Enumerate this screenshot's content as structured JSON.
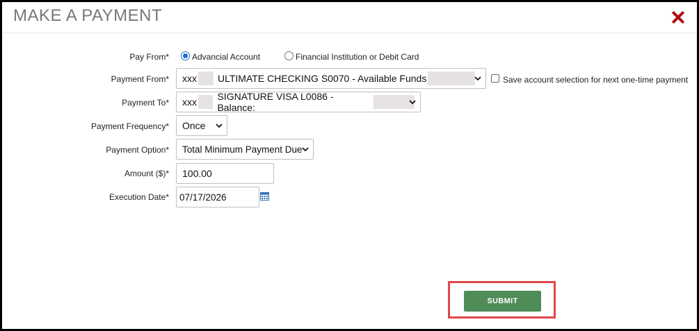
{
  "dialog": {
    "title": "MAKE A PAYMENT"
  },
  "form": {
    "pay_from": {
      "label": "Pay From*",
      "options": [
        {
          "label": "Advancial Account",
          "selected": true
        },
        {
          "label": "Financial Institution or Debit Card",
          "selected": false
        }
      ]
    },
    "payment_from": {
      "label": "Payment From*",
      "prefix": "xxx",
      "value": "ULTIMATE CHECKING S0070 - Available Funds",
      "save_checkbox_label": "Save account selection for next one-time payment",
      "save_checked": false
    },
    "payment_to": {
      "label": "Payment To*",
      "prefix": "xxx",
      "value": "SIGNATURE VISA L0086 - Balance:"
    },
    "payment_frequency": {
      "label": "Payment Frequency*",
      "value": "Once"
    },
    "payment_option": {
      "label": "Payment Option*",
      "value": "Total Minimum Payment Due"
    },
    "amount": {
      "label": "Amount ($)*",
      "value": "100.00"
    },
    "execution_date": {
      "label": "Execution Date*",
      "value": "07/17/2026"
    }
  },
  "actions": {
    "submit_label": "SUBMIT"
  },
  "colors": {
    "close": "#b00f14",
    "submit": "#4f8c58",
    "highlight": "#e0474c",
    "radio_accent": "#1e6fd0"
  },
  "icons": [
    "close-icon",
    "chevron-down-icon",
    "calendar-icon"
  ]
}
